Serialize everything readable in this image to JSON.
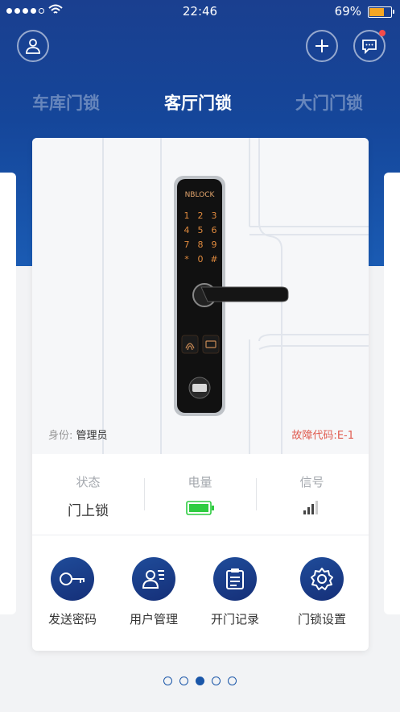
{
  "status_bar": {
    "time": "22:46",
    "battery": "69%",
    "battery_level": 0.69
  },
  "header": {
    "avatar_icon": "user-icon",
    "add_icon": "plus-icon",
    "messages_icon": "chat-icon",
    "has_unread": true
  },
  "tabs": [
    {
      "label": "车库门锁",
      "active": false
    },
    {
      "label": "客厅门锁",
      "active": true
    },
    {
      "label": "大门门锁",
      "active": false
    }
  ],
  "lock": {
    "brand": "NBLOCK",
    "keys": [
      "1",
      "2",
      "3",
      "4",
      "5",
      "6",
      "7",
      "8",
      "9",
      "*",
      "0",
      "#"
    ],
    "role_label": "身份:",
    "role_value": "管理员",
    "fault_label": "故障代码:",
    "fault_value": "E-1"
  },
  "status": [
    {
      "label": "状态",
      "value": "门上锁"
    },
    {
      "label": "电量",
      "value": "",
      "icon": "battery-full-icon"
    },
    {
      "label": "信号",
      "value": "",
      "icon": "signal-bars-icon"
    }
  ],
  "actions": [
    {
      "label": "发送密码",
      "icon": "key-icon"
    },
    {
      "label": "用户管理",
      "icon": "user-manage-icon"
    },
    {
      "label": "开门记录",
      "icon": "clipboard-icon"
    },
    {
      "label": "门锁设置",
      "icon": "gear-icon"
    }
  ],
  "pager": {
    "total": 5,
    "active_index": 2
  },
  "colors": {
    "primary": "#1a4fa0",
    "fault": "#e05a4e",
    "battery_green": "#2ecc40",
    "tab_active": "#ffffff"
  }
}
